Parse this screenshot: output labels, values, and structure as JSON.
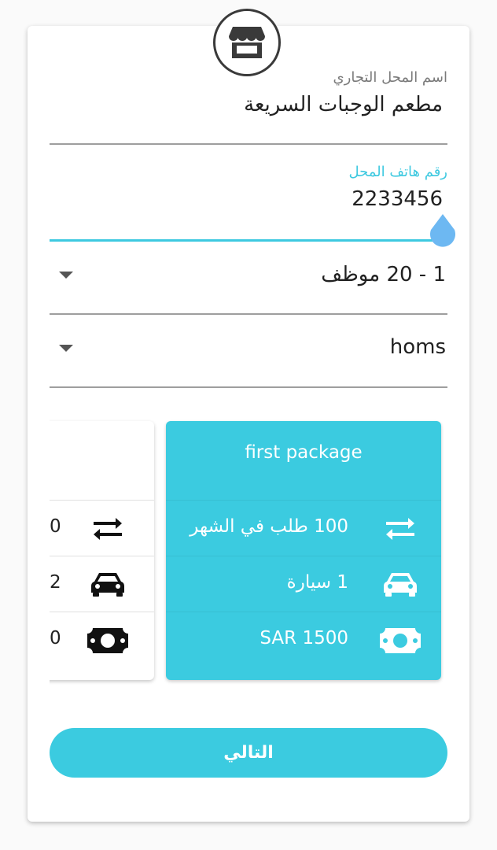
{
  "form": {
    "shop_name": {
      "label": "اسم المحل التجاري",
      "value": "مطعم الوجبات السريعة"
    },
    "shop_phone": {
      "label": "رقم هاتف المحل",
      "value": "2233456"
    },
    "employees_select": {
      "value": "1 - 20 موظف"
    },
    "city_select": {
      "value": "homs"
    }
  },
  "packages": [
    {
      "title": "first package",
      "requests": "100 طلب في الشهر",
      "cars": "1 سيارة",
      "price": "SAR 1500"
    },
    {
      "title": "",
      "requests": "0",
      "cars": "2",
      "price": "0"
    }
  ],
  "next_button": {
    "label": "التالي"
  },
  "colors": {
    "accent": "#3bcbe0",
    "cursor_handle": "#6db8f2",
    "text": "#212121"
  },
  "icons": {
    "header": "store-icon",
    "requests": "swap-arrows-icon",
    "cars": "car-icon",
    "price": "banknote-icon"
  }
}
